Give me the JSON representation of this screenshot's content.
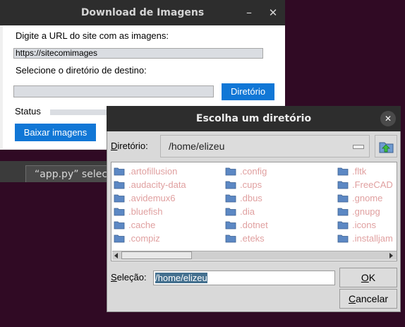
{
  "main_window": {
    "title": "Download de Imagens",
    "url_label": "Digite a URL do site com as imagens:",
    "url_value": "https://sitecomimages",
    "dir_label": "Selecione o diretório de destino:",
    "dir_button": "Diretório",
    "status_label": "Status",
    "download_button": "Baixar imagens",
    "controls": {
      "minimize": "–",
      "close": "✕"
    }
  },
  "editor": {
    "tab_label": "“app.py” selecion"
  },
  "dialog": {
    "title": "Escolha um diretório",
    "close": "✕",
    "dir_label_prefix": "D",
    "dir_label_rest": "iretório:",
    "dir_value": "/home/elizeu",
    "files": [
      ".artofillusion",
      ".audacity-data",
      ".avidemux6",
      ".bluefish",
      ".cache",
      ".compiz",
      ".config",
      ".cups",
      ".dbus",
      ".dia",
      ".dotnet",
      ".eteks",
      ".fltk",
      ".FreeCAD",
      ".gnome",
      ".gnupg",
      ".icons",
      ".installjam"
    ],
    "selection_label_prefix": "S",
    "selection_label_rest": "eleção:",
    "selection_value": "/home/elizeu",
    "ok_prefix": "O",
    "ok_rest": "K",
    "cancel_prefix": "C",
    "cancel_rest": "ancelar",
    "colors": {
      "folder": "#5c88c4",
      "entry_text": "#e0a0a0",
      "accent": "#1177d6"
    }
  }
}
